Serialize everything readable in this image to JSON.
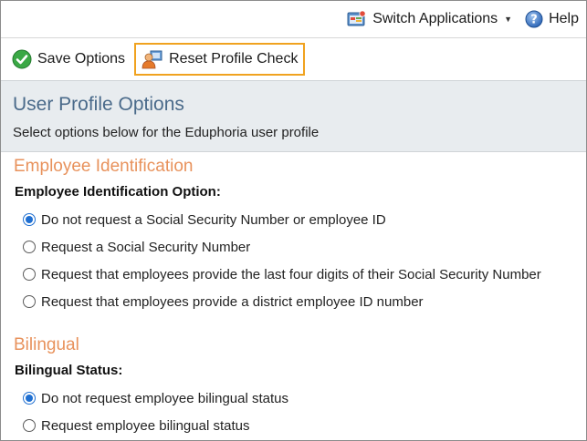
{
  "topbar": {
    "switch_label": "Switch Applications",
    "help_label": "Help"
  },
  "toolbar": {
    "save_label": "Save Options",
    "reset_label": "Reset Profile Check",
    "highlight_color": "#f0a21f"
  },
  "header": {
    "title": "User Profile Options",
    "subtitle": "Select options below for the Eduphoria user profile"
  },
  "sections": [
    {
      "title": "Employee Identification",
      "group_label": "Employee Identification Option:",
      "options": [
        {
          "label": "Do not request a Social Security Number or employee ID",
          "checked": true
        },
        {
          "label": "Request a Social Security Number",
          "checked": false
        },
        {
          "label": "Request that employees provide the last four digits of their Social Security Number",
          "checked": false
        },
        {
          "label": "Request that employees provide a district employee ID number",
          "checked": false
        }
      ]
    },
    {
      "title": "Bilingual",
      "group_label": "Bilingual Status:",
      "options": [
        {
          "label": "Do not request employee bilingual status",
          "checked": true
        },
        {
          "label": "Request employee bilingual status",
          "checked": false
        }
      ]
    }
  ],
  "icons": {
    "switch": "switch-applications-icon",
    "help": "help-icon",
    "save": "checkmark-icon",
    "reset": "user-reset-icon"
  },
  "colors": {
    "section_title": "#e8925c",
    "page_title": "#4a6a8a",
    "header_bg": "#e8ecef",
    "radio_selected": "#1f6fd1"
  }
}
